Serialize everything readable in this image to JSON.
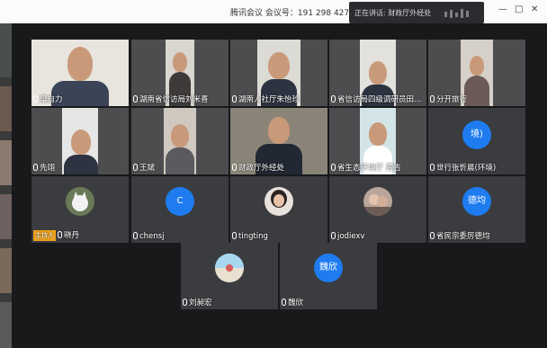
{
  "title_bar": {
    "title": "腾讯会议 会议号：191 298 427",
    "speaking_prefix": "正在讲话:",
    "speaking_name": "财政厅外经处"
  },
  "window_controls": [
    "—",
    "□",
    "✕"
  ],
  "colors": {
    "avatar_blue": "#1e7cf0",
    "host_badge": "#f0a21a",
    "tile_bg": "#3b3c3f"
  },
  "participants": [
    {
      "name": "梁自力",
      "type": "video"
    },
    {
      "name": "湖南省信访局刘米喜",
      "type": "video"
    },
    {
      "name": "湖南人社厅朱怡珍",
      "type": "video"
    },
    {
      "name": "省信访局四级调研员田...",
      "type": "video"
    },
    {
      "name": "分开旅行",
      "type": "video"
    },
    {
      "name": "先翊",
      "type": "video"
    },
    {
      "name": "王斌",
      "type": "video"
    },
    {
      "name": "财政厅外经处",
      "type": "video"
    },
    {
      "name": "省生态环境厅 周吉",
      "type": "video"
    },
    {
      "name": "世行张忻晨(环境)",
      "type": "avatar",
      "avatar_text": "境)"
    },
    {
      "name": "晓丹",
      "type": "avatar",
      "host_label": "主持人",
      "avatar_text": ""
    },
    {
      "name": "chensj",
      "type": "avatar",
      "avatar_text": "C"
    },
    {
      "name": "tingting",
      "type": "avatar",
      "avatar_text": ""
    },
    {
      "name": "jodiexv",
      "type": "avatar",
      "avatar_text": ""
    },
    {
      "name": "省民宗委厉德均",
      "type": "avatar",
      "avatar_text": "德均"
    },
    {
      "name": "刘昶宏",
      "type": "avatar",
      "avatar_text": ""
    },
    {
      "name": "魏欣",
      "type": "avatar",
      "avatar_text": "魏欣"
    }
  ]
}
